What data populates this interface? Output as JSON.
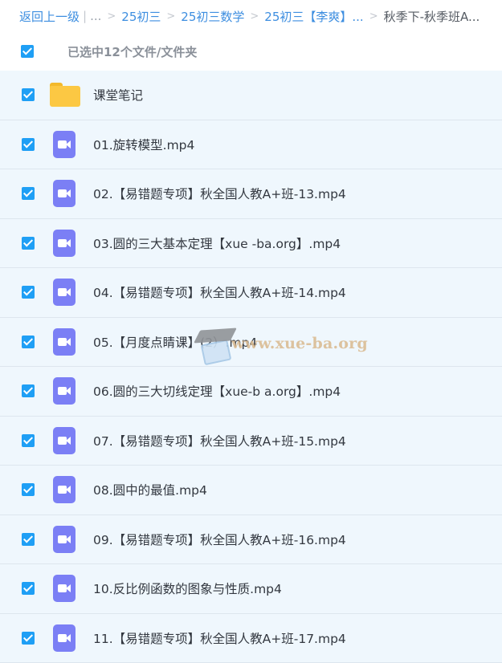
{
  "breadcrumb": {
    "back": "返回上一级",
    "pipe": "|",
    "ellipsis": "...",
    "sep": ">",
    "items": [
      "25初三",
      "25初三数学",
      "25初三【李爽】..."
    ],
    "current": "秋季下-秋季班A..."
  },
  "selection": {
    "text": "已选中12个文件/文件夹",
    "checked": true
  },
  "files": [
    {
      "name": "课堂笔记",
      "type": "folder",
      "icon": "folder-icon"
    },
    {
      "name": "01.旋转模型.mp4",
      "type": "video",
      "icon": "video-icon"
    },
    {
      "name": "02.【易错题专项】秋全国人教A+班-13.mp4",
      "type": "video",
      "icon": "video-icon"
    },
    {
      "name": "03.圆的三大基本定理【xue -ba.org】.mp4",
      "type": "video",
      "icon": "video-icon"
    },
    {
      "name": "04.【易错题专项】秋全国人教A+班-14.mp4",
      "type": "video",
      "icon": "video-icon"
    },
    {
      "name": "05.【月度点睛课】(2）.mp4",
      "type": "video",
      "icon": "video-icon"
    },
    {
      "name": "06.圆的三大切线定理【xue-b a.org】.mp4",
      "type": "video",
      "icon": "video-icon"
    },
    {
      "name": "07.【易错题专项】秋全国人教A+班-15.mp4",
      "type": "video",
      "icon": "video-icon"
    },
    {
      "name": "08.圆中的最值.mp4",
      "type": "video",
      "icon": "video-icon"
    },
    {
      "name": "09.【易错题专项】秋全国人教A+班-16.mp4",
      "type": "video",
      "icon": "video-icon"
    },
    {
      "name": "10.反比例函数的图象与性质.mp4",
      "type": "video",
      "icon": "video-icon"
    },
    {
      "name": "11.【易错题专项】秋全国人教A+班-17.mp4",
      "type": "video",
      "icon": "video-icon"
    }
  ],
  "watermark": {
    "text": "www.xue-ba.org"
  },
  "colors": {
    "accent": "#1f9ff5",
    "link": "#3d8ee0",
    "row_bg": "#eff7fd",
    "video_icon": "#7b7ff5",
    "folder": "#fcc843"
  }
}
